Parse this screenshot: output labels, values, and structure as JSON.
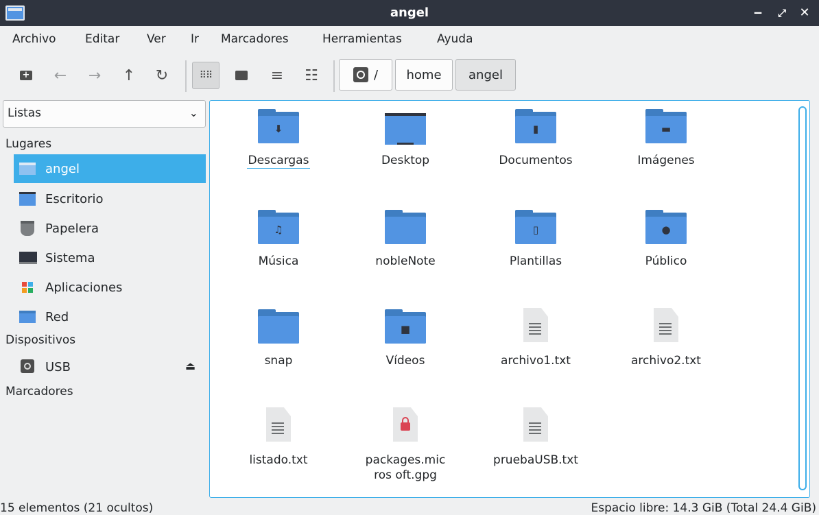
{
  "window": {
    "title": "angel",
    "minimize": "‒",
    "maximize": "⤢",
    "close": "✕"
  },
  "menu": [
    "Archivo",
    "Editar",
    "Ver",
    "Ir",
    "Marcadores",
    "Herramientas",
    "Ayuda"
  ],
  "toolbar": {
    "new_tab_icon": "new-tab-icon",
    "breadcrumb": [
      "/",
      "home",
      "angel"
    ]
  },
  "sidebar": {
    "select_value": "Listas",
    "sections": {
      "places": "Lugares",
      "devices": "Dispositivos",
      "bookmarks": "Marcadores"
    },
    "places": [
      {
        "label": "angel",
        "icon": "home-folder-icon"
      },
      {
        "label": "Escritorio",
        "icon": "desktop-icon"
      },
      {
        "label": "Papelera",
        "icon": "trash-icon"
      },
      {
        "label": "Sistema",
        "icon": "computer-icon"
      },
      {
        "label": "Aplicaciones",
        "icon": "applications-icon"
      },
      {
        "label": "Red",
        "icon": "network-icon"
      }
    ],
    "devices": [
      {
        "label": "USB",
        "icon": "usb-drive-icon"
      }
    ]
  },
  "files": [
    {
      "name": "Descargas",
      "type": "folder",
      "emblem": "⬇"
    },
    {
      "name": "Desktop",
      "type": "desktop",
      "emblem": ""
    },
    {
      "name": "Documentos",
      "type": "folder",
      "emblem": "▮"
    },
    {
      "name": "Imágenes",
      "type": "folder",
      "emblem": "▬"
    },
    {
      "name": "Música",
      "type": "folder",
      "emblem": "♫"
    },
    {
      "name": "nobleNote",
      "type": "folder",
      "emblem": ""
    },
    {
      "name": "Plantillas",
      "type": "folder",
      "emblem": "▯"
    },
    {
      "name": "Público",
      "type": "folder",
      "emblem": "●"
    },
    {
      "name": "snap",
      "type": "folder",
      "emblem": ""
    },
    {
      "name": "Vídeos",
      "type": "folder",
      "emblem": "■"
    },
    {
      "name": "archivo1.txt",
      "type": "text",
      "emblem": ""
    },
    {
      "name": "archivo2.txt",
      "type": "text",
      "emblem": ""
    },
    {
      "name": "listado.txt",
      "type": "text",
      "emblem": ""
    },
    {
      "name": "packages.micros oft.gpg",
      "type": "lock",
      "emblem": ""
    },
    {
      "name": "pruebaUSB.txt",
      "type": "text",
      "emblem": ""
    }
  ],
  "status": {
    "left": "15 elementos (21 ocultos)",
    "right": "Espacio libre: 14.3 GiB (Total 24.4 GiB)"
  }
}
